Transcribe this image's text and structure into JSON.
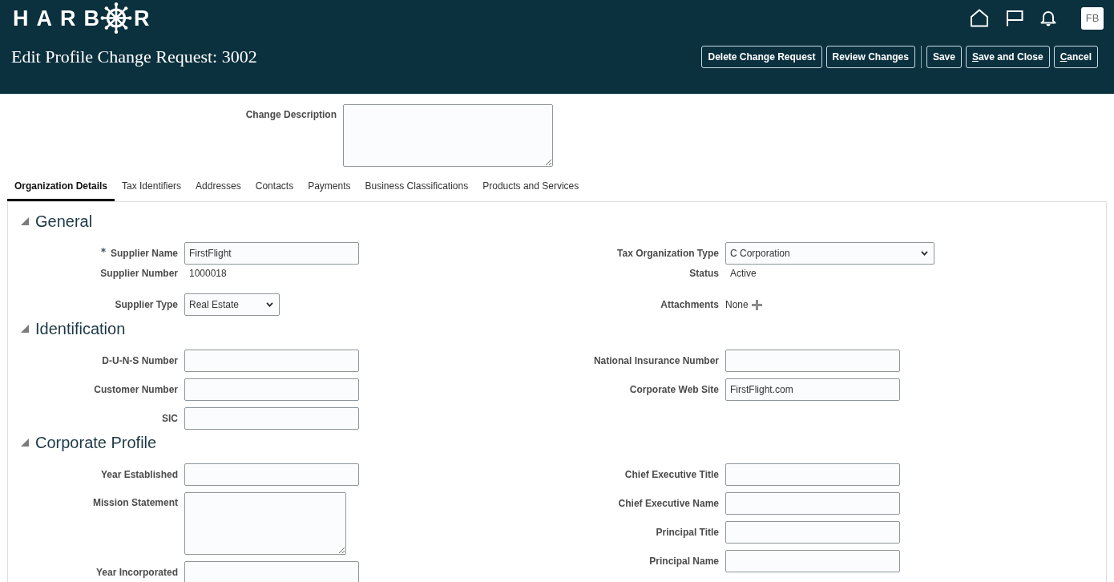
{
  "header": {
    "logo": {
      "before_wheel": "HARB",
      "after_wheel": "R"
    },
    "avatar": "FB",
    "title": "Edit Profile Change Request: 3002",
    "action_groups": [
      [
        {
          "label": "Delete Change Request",
          "mnemonic": false
        },
        {
          "label": "Review Changes",
          "mnemonic": false
        }
      ],
      [
        {
          "label": "Save",
          "mnemonic": false
        },
        {
          "label": "Save and Close",
          "mnemonic": true
        },
        {
          "label": "Cancel",
          "mnemonic": true
        }
      ]
    ]
  },
  "change_description": {
    "label": "Change Description"
  },
  "tabs": [
    {
      "label": "Organization Details",
      "selected": true
    },
    {
      "label": "Tax Identifiers",
      "selected": false
    },
    {
      "label": "Addresses",
      "selected": false
    },
    {
      "label": "Contacts",
      "selected": false
    },
    {
      "label": "Payments",
      "selected": false
    },
    {
      "label": "Business Classifications",
      "selected": false
    },
    {
      "label": "Products and Services",
      "selected": false
    }
  ],
  "sections": [
    {
      "title": "General",
      "expanded": true,
      "left": [
        {
          "label": "Supplier Name",
          "kind": "input",
          "value": "FirstFlight",
          "required": true
        },
        {
          "label": "Supplier Number",
          "kind": "text",
          "value": "1000018",
          "required": false
        },
        {
          "label": "Supplier Type",
          "kind": "select",
          "value": "Real Estate",
          "required": false
        }
      ],
      "right": [
        {
          "label": "Tax Organization Type",
          "kind": "select",
          "value": "C Corporation",
          "required": false
        },
        {
          "label": "Status",
          "kind": "text",
          "value": "Active",
          "required": false
        },
        {
          "label": "Attachments",
          "kind": "attachments",
          "value": "None",
          "required": false
        }
      ]
    },
    {
      "title": "Identification",
      "expanded": true,
      "left": [
        {
          "label": "D-U-N-S Number",
          "kind": "input",
          "required": false
        },
        {
          "label": "Customer Number",
          "kind": "input",
          "required": false
        },
        {
          "label": "SIC",
          "kind": "input",
          "required": false
        }
      ],
      "right": [
        {
          "label": "National Insurance Number",
          "kind": "input",
          "required": false
        },
        {
          "label": "Corporate Web Site",
          "kind": "input",
          "value": "FirstFlight.com",
          "required": false
        }
      ]
    },
    {
      "title": "Corporate Profile",
      "expanded": true,
      "left": [
        {
          "label": "Year Established",
          "kind": "input",
          "required": false
        },
        {
          "label": "Mission Statement",
          "kind": "textarea",
          "required": false
        },
        {
          "label": "Year Incorporated",
          "kind": "input",
          "required": false
        }
      ],
      "right": [
        {
          "label": "Chief Executive Title",
          "kind": "input",
          "required": false
        },
        {
          "label": "Chief Executive Name",
          "kind": "input",
          "required": false
        },
        {
          "label": "Principal Title",
          "kind": "input",
          "required": false
        },
        {
          "label": "Principal Name",
          "kind": "input",
          "required": false
        }
      ]
    }
  ]
}
